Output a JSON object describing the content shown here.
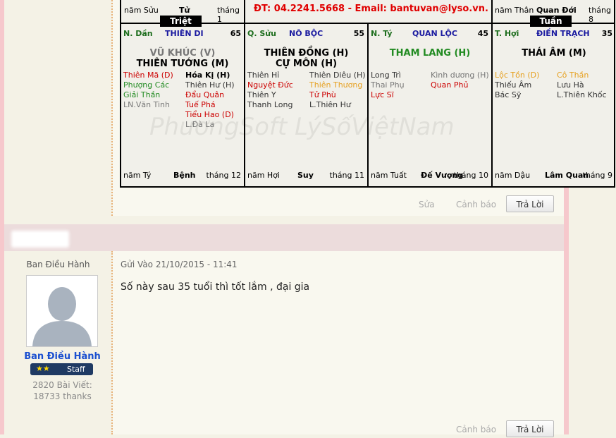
{
  "chart": {
    "top": [
      {
        "left": "năm Sửu",
        "mid": "Tử",
        "right": "tháng 1"
      },
      {
        "contact": "ĐT: 04.2241.5668 - Email: bantuvan@lyso.vn."
      },
      {
        "left": "năm Thân",
        "mid": "Quan Đới",
        "right": "tháng 8"
      }
    ],
    "triet": "Triệt",
    "tuan": "Tuần",
    "watermark": "PhươngSoft   LýSốViệtNam",
    "cells": [
      {
        "branch": "N. Dần",
        "palace": "THIÊN DI",
        "age": "65",
        "main1": "VŨ KHÚC (V)",
        "main2": "THIÊN TƯỚNG (M)",
        "leftStars": [
          {
            "t": "Thiên Mã (D)",
            "c": "#cc0000"
          },
          {
            "t": "Phượng Các",
            "c": "#228b22"
          },
          {
            "t": "Giải Thần",
            "c": "#228b22"
          },
          {
            "t": "LN.Văn Tinh",
            "c": "#777"
          }
        ],
        "rightStars": [
          {
            "t": "Hóa Kị (H)",
            "c": "#000",
            "b": true
          },
          {
            "t": "Thiên Hư (H)",
            "c": "#333"
          },
          {
            "t": "Đẩu Quân",
            "c": "#cc0000"
          },
          {
            "t": "Tuế Phá",
            "c": "#cc0000"
          },
          {
            "t": "Tiểu Hao (D)",
            "c": "#cc0000"
          },
          {
            "t": "L.Đà La",
            "c": "#777"
          }
        ],
        "footL": "năm Tý",
        "footM": "Bệnh",
        "footR": "tháng 12"
      },
      {
        "branch": "Q. Sửu",
        "palace": "NÔ BỘC",
        "age": "55",
        "main1": "THIÊN ĐỒNG (H)",
        "main2": "CỰ MÔN (H)",
        "leftStars": [
          {
            "t": "Thiên Hỉ",
            "c": "#333"
          },
          {
            "t": "Nguyệt Đức",
            "c": "#cc0000"
          },
          {
            "t": "Thiên Y",
            "c": "#333"
          },
          {
            "t": "Thanh Long",
            "c": "#333"
          }
        ],
        "rightStars": [
          {
            "t": "Thiên Diêu (H)",
            "c": "#333"
          },
          {
            "t": "Thiên Thương",
            "c": "#e6a020"
          },
          {
            "t": "Tử Phù",
            "c": "#cc0000"
          },
          {
            "t": "L.Thiên Hư",
            "c": "#333"
          }
        ],
        "footL": "năm Hợi",
        "footM": "Suy",
        "footR": "tháng 11"
      },
      {
        "branch": "N. Tý",
        "palace": "QUAN LỘC",
        "age": "45",
        "main1": "THAM LANG (H)",
        "main2": "",
        "leftStars": [
          {
            "t": "Long Trì",
            "c": "#333"
          },
          {
            "t": "Thai Phụ",
            "c": "#777"
          },
          {
            "t": "Lực Sĩ",
            "c": "#cc0000"
          }
        ],
        "rightStars": [
          {
            "t": "Kình dương (H)",
            "c": "#777"
          },
          {
            "t": "Quan Phủ",
            "c": "#cc0000"
          }
        ],
        "footL": "năm Tuất",
        "footM": "Đế Vượng",
        "footR": "tháng 10"
      },
      {
        "branch": "T. Hợi",
        "palace": "ĐIỀN TRẠCH",
        "age": "35",
        "main1": "THÁI ÂM (M)",
        "main2": "",
        "leftStars": [
          {
            "t": "Lộc Tồn (D)",
            "c": "#e6a020"
          },
          {
            "t": "Thiếu Âm",
            "c": "#333"
          },
          {
            "t": "Bác Sỹ",
            "c": "#333"
          }
        ],
        "rightStars": [
          {
            "t": "Cô Thần",
            "c": "#e6a020"
          },
          {
            "t": "Lưu Hà",
            "c": "#333"
          },
          {
            "t": "L.Thiên Khốc",
            "c": "#333"
          }
        ],
        "footL": "năm Dậu",
        "footM": "Lâm Quan",
        "footR": "tháng 9"
      }
    ]
  },
  "post1": {
    "edit": "Sửa",
    "report": "Cảnh báo",
    "reply": "Trả Lời"
  },
  "post2": {
    "rank": "Ban Điều Hành",
    "username": "Ban Điều Hành",
    "stars": "★★",
    "role": "Staff",
    "posts": "2820 Bài Viết:",
    "thanks": "18733 thanks",
    "sent": "Gửi Vào 21/10/2015 - 11:41",
    "message": "Số này sau 35 tuổi thì tốt lắm , đại gia",
    "report": "Cảnh báo",
    "reply": "Trả Lời"
  },
  "colors": {
    "palace": "#1a1aa0",
    "branch": "#1e6e1e",
    "accent": "#e6a020",
    "red": "#cc0000"
  }
}
